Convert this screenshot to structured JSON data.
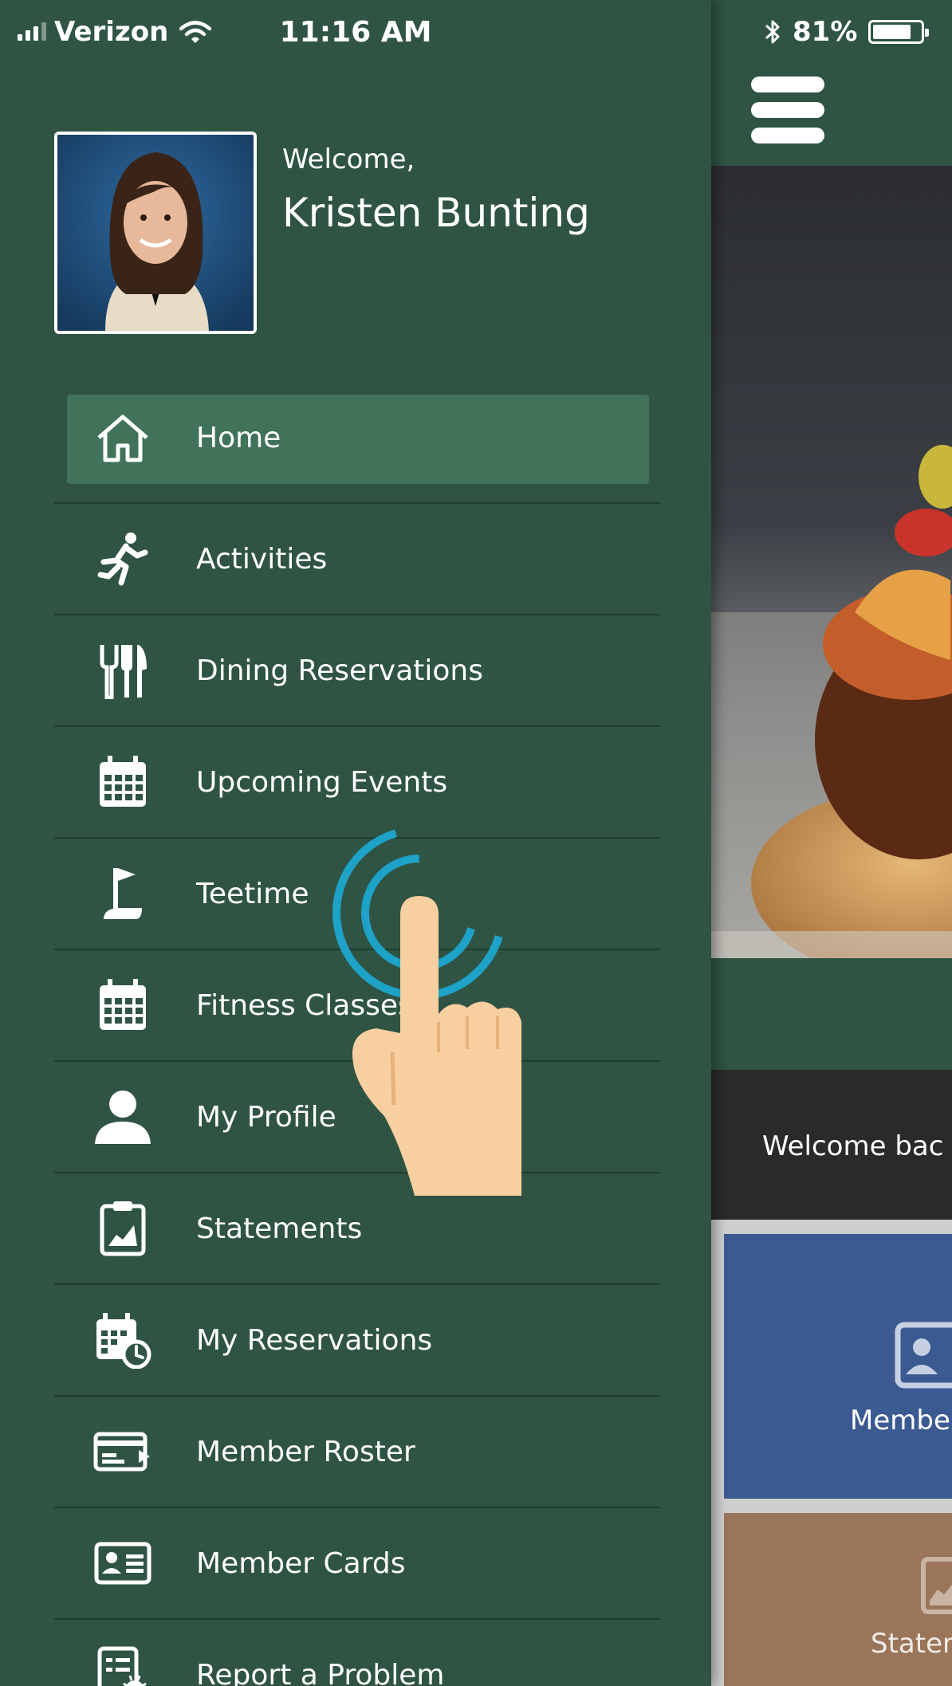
{
  "status_bar": {
    "carrier": "Verizon",
    "time": "11:16 AM",
    "battery": "81%",
    "battery_level": 0.81
  },
  "profile": {
    "greeting": "Welcome,",
    "name": "Kristen Bunting"
  },
  "menu": [
    {
      "label": "Home",
      "icon": "home-icon",
      "active": true
    },
    {
      "label": "Activities",
      "icon": "running-person-icon"
    },
    {
      "label": "Dining Reservations",
      "icon": "utensils-icon"
    },
    {
      "label": "Upcoming Events",
      "icon": "calendar-icon"
    },
    {
      "label": "Teetime",
      "icon": "golf-flag-icon"
    },
    {
      "label": "Fitness Classes",
      "icon": "calendar-icon"
    },
    {
      "label": "My Profile",
      "icon": "user-icon"
    },
    {
      "label": "Statements",
      "icon": "clipboard-chart-icon"
    },
    {
      "label": "My Reservations",
      "icon": "calendar-clock-icon"
    },
    {
      "label": "Member Roster",
      "icon": "card-list-icon"
    },
    {
      "label": "Member Cards",
      "icon": "id-card-icon"
    },
    {
      "label": "Report a Problem",
      "icon": "bug-report-icon"
    }
  ],
  "main": {
    "welcome_text": "Welcome bac",
    "tiles": [
      {
        "label": "Membe",
        "icon": "id-card-icon"
      },
      {
        "label": "Stater",
        "icon": "clipboard-chart-icon"
      }
    ]
  },
  "colors": {
    "drawer_bg": "#2f5443",
    "active_item": "#41725a",
    "tile_members": "#3c5a92",
    "tile_statements": "#9a755a",
    "tap_ring": "#1ea2c7"
  }
}
